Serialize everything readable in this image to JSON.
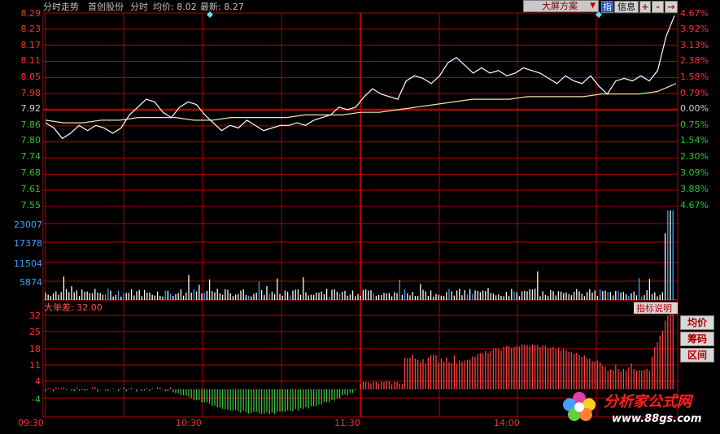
{
  "header": {
    "mode_label": "分时走势",
    "stock_name": "首创股份",
    "period_label": "分时",
    "avg_label": "均价: 8.02",
    "last_label": "最新: 8.27"
  },
  "toolbar": {
    "layout_select": "大屏方案",
    "indicator_btn": "指",
    "info_btn": "信息",
    "plus_btn": "+",
    "minus_btn": "-",
    "next_btn": "→"
  },
  "price_axis": {
    "left": [
      "8.29",
      "8.23",
      "8.17",
      "8.11",
      "8.05",
      "7.98",
      "7.92",
      "7.86",
      "7.80",
      "7.74",
      "7.68",
      "7.61",
      "7.55"
    ],
    "right": [
      "4.67%",
      "3.92%",
      "3.13%",
      "2.38%",
      "1.58%",
      "0.79%",
      "0.00%",
      "0.75%",
      "1.54%",
      "2.30%",
      "3.09%",
      "3.88%",
      "4.67%"
    ],
    "prev_close": 7.92
  },
  "volume_axis": [
    "23007",
    "17378",
    "11504",
    "5874"
  ],
  "indicator": {
    "title": "大单差: 32.00",
    "help_label": "指标说明",
    "axis": [
      "32",
      "25",
      "18",
      "11",
      "4",
      "-4"
    ]
  },
  "side_buttons": [
    "均价",
    "筹码",
    "区间"
  ],
  "time_axis": [
    "09:30",
    "10:30",
    "11:30",
    "14:00"
  ],
  "logo": {
    "brand": "分析家公式网",
    "url": "www.88gs.com"
  },
  "colors": {
    "grid": "#b40000",
    "price_line": "#ffffff",
    "avg_line": "#e8e8b0",
    "up": "#ff4040",
    "down": "#40c040",
    "axis_up": "#ff3030",
    "axis_down": "#30c030",
    "axis_vol": "#40a0ff"
  },
  "chart_data": {
    "type": "line",
    "title": "",
    "series": [
      {
        "name": "分时",
        "values": [
          7.87,
          7.85,
          7.81,
          7.83,
          7.86,
          7.84,
          7.86,
          7.85,
          7.83,
          7.85,
          7.9,
          7.93,
          7.96,
          7.95,
          7.91,
          7.89,
          7.93,
          7.95,
          7.94,
          7.9,
          7.87,
          7.84,
          7.86,
          7.85,
          7.88,
          7.86,
          7.84,
          7.85,
          7.86,
          7.86,
          7.87,
          7.86,
          7.88,
          7.89,
          7.9,
          7.93,
          7.92,
          7.93,
          7.97,
          8.0,
          7.98,
          7.97,
          7.96,
          8.03,
          8.05,
          8.04,
          8.02,
          8.05,
          8.1,
          8.12,
          8.09,
          8.06,
          8.08,
          8.06,
          8.07,
          8.05,
          8.06,
          8.08,
          8.07,
          8.06,
          8.04,
          8.02,
          8.05,
          8.03,
          8.02,
          8.05,
          8.01,
          7.98,
          8.03,
          8.04,
          8.03,
          8.05,
          8.03,
          8.07,
          8.2,
          8.28
        ]
      },
      {
        "name": "均价",
        "values": [
          7.88,
          7.87,
          7.87,
          7.88,
          7.88,
          7.89,
          7.89,
          7.89,
          7.88,
          7.88,
          7.89,
          7.89,
          7.89,
          7.89,
          7.9,
          7.9,
          7.9,
          7.91,
          7.91,
          7.92,
          7.93,
          7.94,
          7.95,
          7.96,
          7.96,
          7.96,
          7.97,
          7.97,
          7.97,
          7.97,
          7.98,
          7.98,
          7.98,
          7.99,
          8.02
        ]
      }
    ],
    "ylim": [
      7.55,
      8.29
    ],
    "xlabel": "",
    "ylabel": ""
  }
}
